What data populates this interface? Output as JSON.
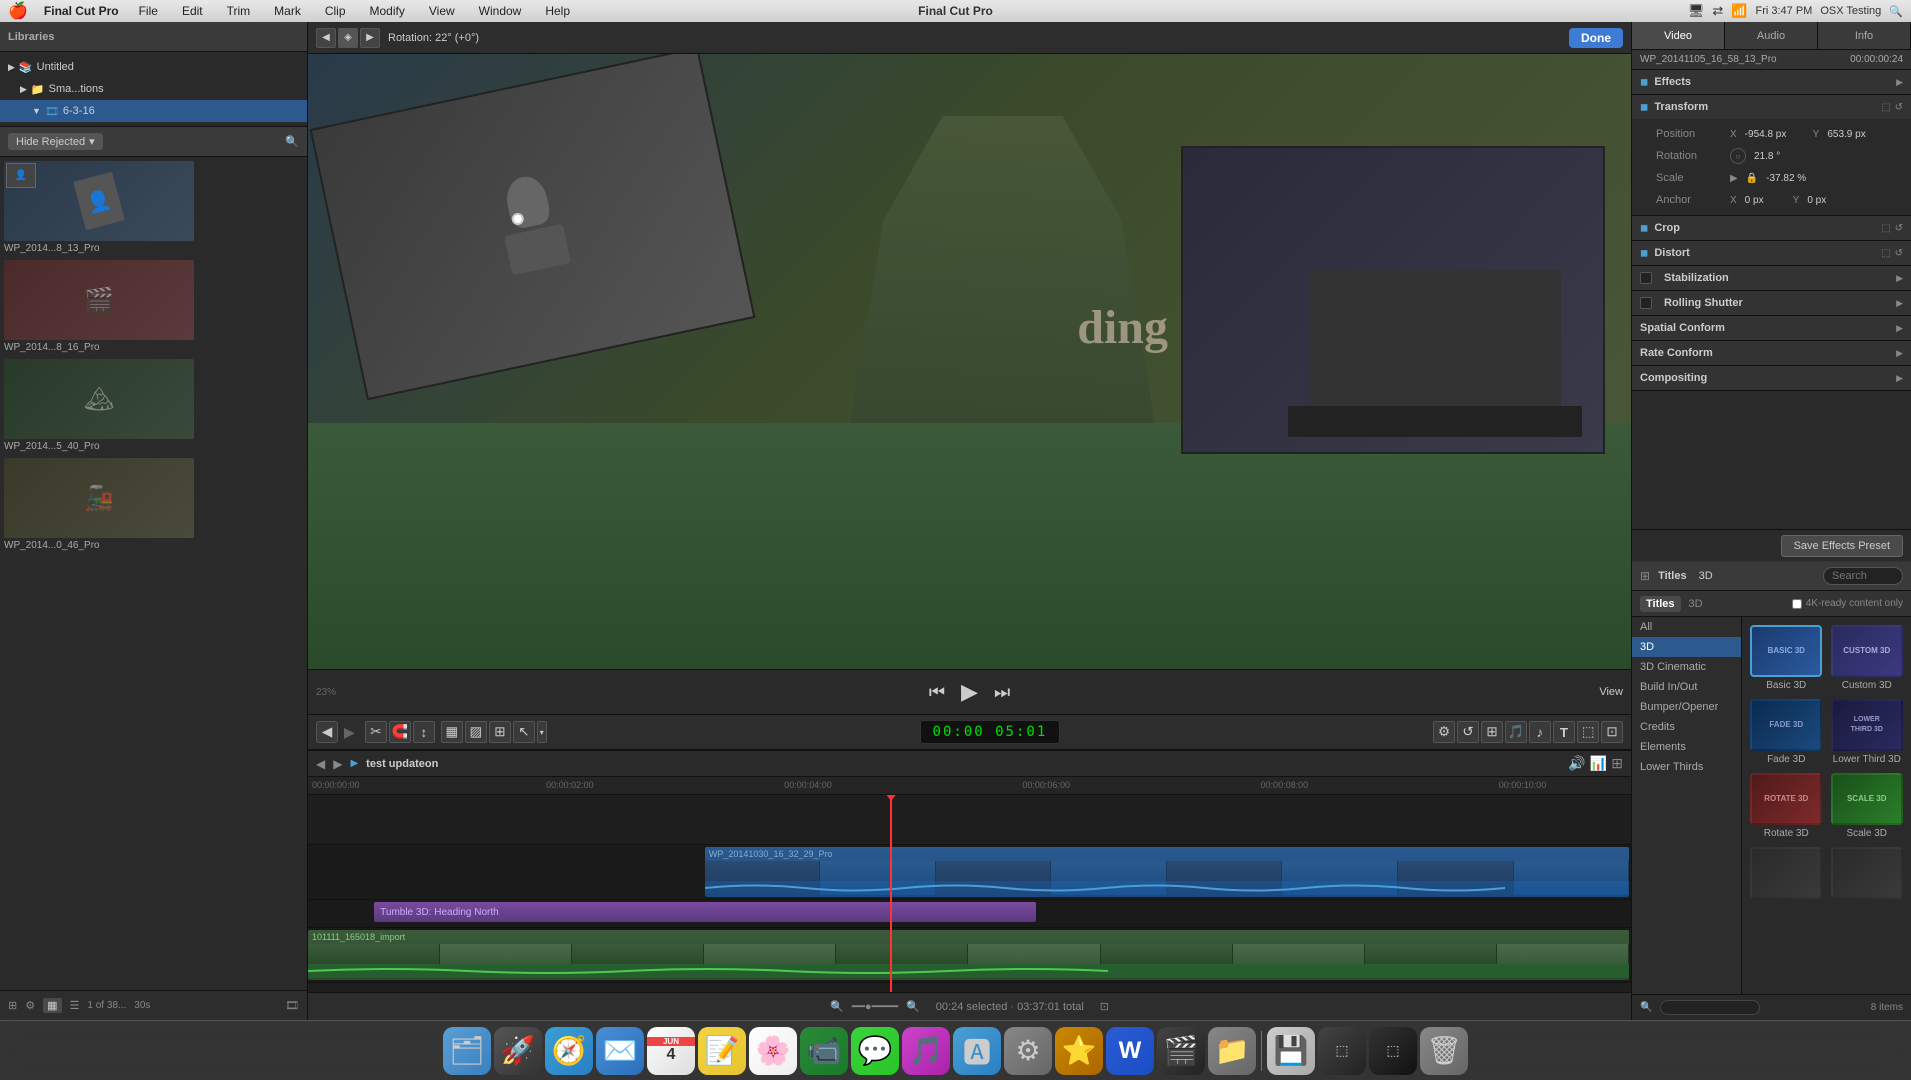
{
  "menubar": {
    "apple": "🍎",
    "app_name": "Final Cut Pro",
    "menus": [
      "File",
      "Edit",
      "Trim",
      "Mark",
      "Clip",
      "Modify",
      "View",
      "Window",
      "Help"
    ],
    "center_title": "Final Cut Pro",
    "time": "Fri 3:47 PM",
    "user": "OSX Testing"
  },
  "library": {
    "header": "Libraries",
    "items": [
      {
        "label": "Untitled",
        "type": "library",
        "expanded": true
      },
      {
        "label": "Sma...tions",
        "type": "folder",
        "indent": 1
      },
      {
        "label": "6-3-16",
        "type": "event",
        "indent": 2,
        "selected": true
      }
    ],
    "filter_label": "Hide Rejected",
    "clip_count": "1 of 38...",
    "clip_duration": "30s",
    "clips": [
      {
        "name": "WP_2014...8_13_Pro"
      },
      {
        "name": "WP_2014...8_16_Pro"
      },
      {
        "name": "WP_2014...5_40_Pro"
      },
      {
        "name": "WP_2014...0_46_Pro"
      }
    ]
  },
  "preview": {
    "rotation_label": "Rotation: 22° (+0°)",
    "zoom_label": "23%",
    "view_label": "View",
    "timecode": "00:00:00:24",
    "done_btn": "Done",
    "transport": {
      "goto_start": "⏮",
      "play": "▶",
      "goto_end": "⏭"
    },
    "clip_name": "WP_20141105_16_58_13_Pro"
  },
  "inspector": {
    "tabs": [
      "Video",
      "Audio",
      "Info"
    ],
    "active_tab": "Video",
    "clip_name": "WP_20141105_16_58_13_Pro",
    "clip_timecode": "00:00:00:24",
    "sections": {
      "effects": {
        "label": "Effects"
      },
      "transform": {
        "label": "Transform",
        "position": {
          "x": "-954.8 px",
          "y": "653.9 px"
        },
        "rotation": "21.8 °",
        "scale": "-37.82 %",
        "anchor": {
          "x": "0 px",
          "y": "0 px"
        }
      },
      "crop": {
        "label": "Crop"
      },
      "distort": {
        "label": "Distort"
      },
      "stabilization": {
        "label": "Stabilization"
      },
      "rolling_shutter": {
        "label": "Rolling Shutter"
      },
      "spatial_conform": {
        "label": "Spatial Conform"
      },
      "rate_conform": {
        "label": "Rate Conform"
      },
      "compositing": {
        "label": "Compositing"
      }
    }
  },
  "effects_browser": {
    "title": "Titles",
    "mode": "3D",
    "checkbox_label": "4K-ready content only",
    "categories": [
      "All",
      "3D",
      "3D Cinematic",
      "Build In/Out",
      "Bumper/Opener",
      "Credits",
      "Elements",
      "Lower Thirds"
    ],
    "selected_category": "3D",
    "effects": [
      {
        "id": "basic3d",
        "label": "Basic 3D",
        "selected": true,
        "class": "basic3d-thumb"
      },
      {
        "id": "custom3d",
        "label": "Custom 3D",
        "selected": false,
        "class": "custom3d-thumb"
      },
      {
        "id": "fade3d",
        "label": "Fade 3D",
        "selected": false,
        "class": "fade3d-thumb"
      },
      {
        "id": "lowerthird3d",
        "label": "Lower Third 3D",
        "selected": false,
        "class": "lowerthird-thumb"
      },
      {
        "id": "rotate3d",
        "label": "Rotate 3D",
        "selected": false,
        "class": "rotate3d-thumb"
      },
      {
        "id": "scale3d",
        "label": "Scale 3D",
        "selected": false,
        "class": "scale3d-thumb"
      }
    ],
    "item_count": "8 items",
    "search_placeholder": "Search",
    "save_preset_btn": "Save Effects Preset"
  },
  "timeline": {
    "project_name": "test updateon",
    "timecode": "5:01",
    "timecode_full": "00:00  05:01",
    "status_bar": "00:24 selected · 03:37:01 total",
    "markers": [
      "00:00:00:00",
      "00:00:02:00",
      "00:00:04:00",
      "00:00:06:00",
      "00:00:08:00",
      "00:00:10:00"
    ],
    "clips": [
      {
        "label": "WP_20141030_16_32_29_Pro",
        "type": "blue"
      },
      {
        "label": "Tumble 3D: Heading North",
        "type": "purple"
      },
      {
        "label": "101111_165018_import",
        "type": "green"
      }
    ]
  },
  "dock": {
    "apps": [
      {
        "name": "Finder",
        "icon": "🗂",
        "color": "#4a90d9"
      },
      {
        "name": "Launchpad",
        "icon": "🚀",
        "color": "#e8e8e8"
      },
      {
        "name": "Safari",
        "icon": "🧭",
        "color": "#4a90d9"
      },
      {
        "name": "Mail",
        "icon": "✉",
        "color": "#4a90d9"
      },
      {
        "name": "Calendar",
        "icon": "📅",
        "color": "#e44"
      },
      {
        "name": "Stickies",
        "icon": "📝",
        "color": "#f5d020"
      },
      {
        "name": "Photos",
        "icon": "🌸",
        "color": "#fff"
      },
      {
        "name": "FaceTime",
        "icon": "📹",
        "color": "#2a2"
      },
      {
        "name": "Messages",
        "icon": "💬",
        "color": "#4a90d9"
      },
      {
        "name": "iTunes",
        "icon": "🎵",
        "color": "#c844c8"
      },
      {
        "name": "App Store",
        "icon": "🅰",
        "color": "#4a90d9"
      },
      {
        "name": "System Preferences",
        "icon": "⚙",
        "color": "#888"
      },
      {
        "name": "Reeder",
        "icon": "⭐",
        "color": "#f90"
      },
      {
        "name": "Word",
        "icon": "W",
        "color": "#2a5cd4"
      },
      {
        "name": "Final Cut Pro",
        "icon": "🎬",
        "color": "#333"
      },
      {
        "name": "Finder2",
        "icon": "📁",
        "color": "#888"
      },
      {
        "name": "Facetime2",
        "icon": "📱",
        "color": "#222"
      },
      {
        "name": "Trash",
        "icon": "🗑",
        "color": "#888"
      }
    ]
  }
}
